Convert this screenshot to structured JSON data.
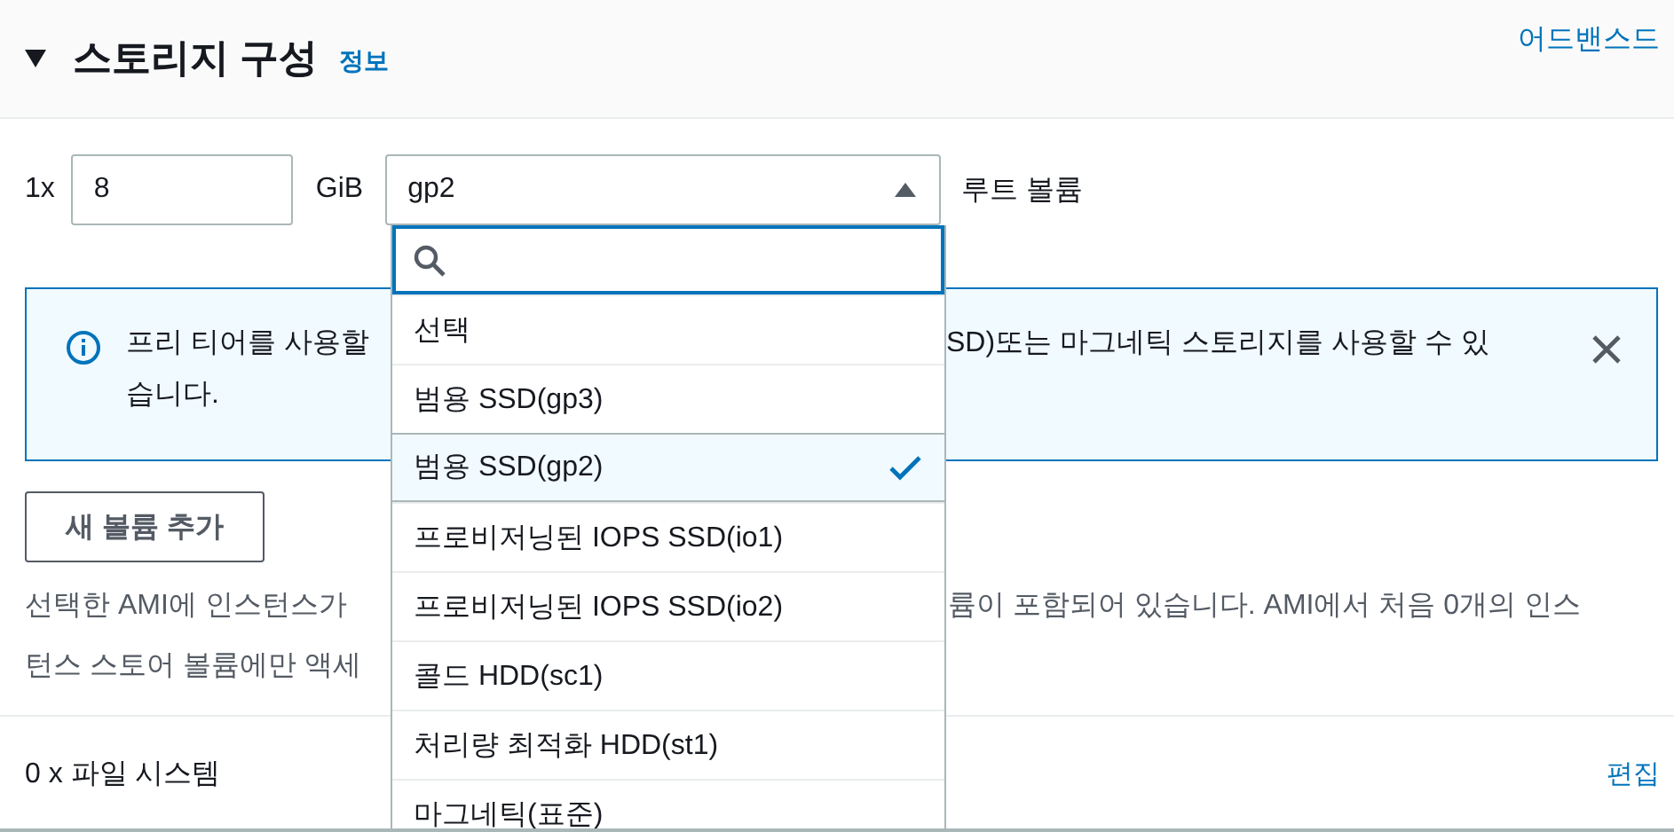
{
  "section": {
    "title": "스토리지 구성",
    "info_link": "정보",
    "expanded": true,
    "advanced_link": "어드밴스드"
  },
  "volume": {
    "count": "1x",
    "size": "8",
    "unit": "GiB",
    "type": "gp2",
    "dropdown_open": true,
    "role": "루트 볼륨"
  },
  "dropdown": {
    "options": [
      {
        "label": "선택",
        "selected": false
      },
      {
        "label": "범용 SSD(gp3)",
        "selected": false
      },
      {
        "label": "범용 SSD(gp2)",
        "selected": true
      },
      {
        "label": "프로비저닝된 IOPS SSD(io1)",
        "selected": false
      },
      {
        "label": "프로비저닝된 IOPS SSD(io2)",
        "selected": false
      },
      {
        "label": "콜드 HDD(sc1)",
        "selected": false
      },
      {
        "label": "처리량 최적화 HDD(st1)",
        "selected": false
      },
      {
        "label": "마그네틱(표준)",
        "selected": false
      }
    ]
  },
  "info_alert": {
    "line_1_left": "프리 티어를 사용할",
    "line_1_right": "SD)또는 마그네틱 스토리지를 사용할 수 있",
    "line_2": "습니다."
  },
  "add_volume_button": "새 볼륨 추가",
  "description": {
    "line_1_left": "선택한 AMI에 인스턴스가",
    "line_1_right": "륨이 포함되어 있습니다. AMI에서 처음 0개의 인스",
    "line_2_left": "턴스 스토어 볼륨에만 액세"
  },
  "file_systems": {
    "label": "0 x 파일 시스템",
    "edit_link": "편집"
  }
}
